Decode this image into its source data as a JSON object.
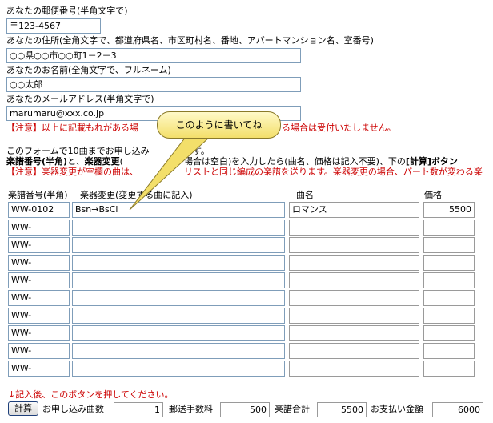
{
  "form": {
    "postal_label": "あなたの郵便番号(半角文字で)",
    "postal_value": "〒123-4567",
    "address_label": "あなたの住所(全角文字で、都道府県名、市区町村名、番地、アパートマンション名、室番号)",
    "address_value": "○○県○○市○○町1－2－3",
    "name_label": "あなたのお名前(全角文字で、フルネーム)",
    "name_value": "○○太郎",
    "email_label": "あなたのメールアドレス(半角文字で)",
    "email_value": "marumaru@xxx.co.jp"
  },
  "notes": {
    "note1": "【注意】以上に記載もれがある場",
    "note1_tail": "る場合は受付いたしません。",
    "intro1": "このフォームで10曲までお申し込み",
    "intro1_tail": "ます。",
    "intro2_a": "楽譜番号(半角)",
    "intro2_b": "と、",
    "intro2_c": "楽器変更",
    "intro2_d": "(",
    "intro2_e": "場合は空白)を入力したら(曲名、価格は記入不要)、下の",
    "intro2_f": "[計算]ボタン",
    "note2_a": "【注意】楽器変更が空欄の曲は、",
    "note2_b": "リストと同じ編成の楽譜を送ります。楽器変更の場合、パート数が変わる楽"
  },
  "callout": {
    "text": "このように書いてね"
  },
  "table": {
    "header_code": "楽譜番号(半角)",
    "header_change": "楽器変更(変更する曲に記入)",
    "header_title": "曲名",
    "header_price": "価格",
    "rows": [
      {
        "code": "WW-0102",
        "change": "Bsn→BsCl",
        "title": "ロマンス",
        "price": "5500"
      },
      {
        "code": "WW-",
        "change": "",
        "title": "",
        "price": ""
      },
      {
        "code": "WW-",
        "change": "",
        "title": "",
        "price": ""
      },
      {
        "code": "WW-",
        "change": "",
        "title": "",
        "price": ""
      },
      {
        "code": "WW-",
        "change": "",
        "title": "",
        "price": ""
      },
      {
        "code": "WW-",
        "change": "",
        "title": "",
        "price": ""
      },
      {
        "code": "WW-",
        "change": "",
        "title": "",
        "price": ""
      },
      {
        "code": "WW-",
        "change": "",
        "title": "",
        "price": ""
      },
      {
        "code": "WW-",
        "change": "",
        "title": "",
        "price": ""
      },
      {
        "code": "WW-",
        "change": "",
        "title": "",
        "price": ""
      }
    ]
  },
  "footer": {
    "instruction": "↓記入後、このボタンを押してください。",
    "calc_button": "計算",
    "count_label": "お申し込み曲数",
    "count_value": "1",
    "shipping_label": "郵送手数料",
    "shipping_value": "500",
    "subtotal_label": "楽譜合計",
    "subtotal_value": "5500",
    "total_label": "お支払い金額",
    "total_value": "6000"
  },
  "colors": {
    "note": "#cc0000",
    "input_border": "#7f9db9"
  }
}
